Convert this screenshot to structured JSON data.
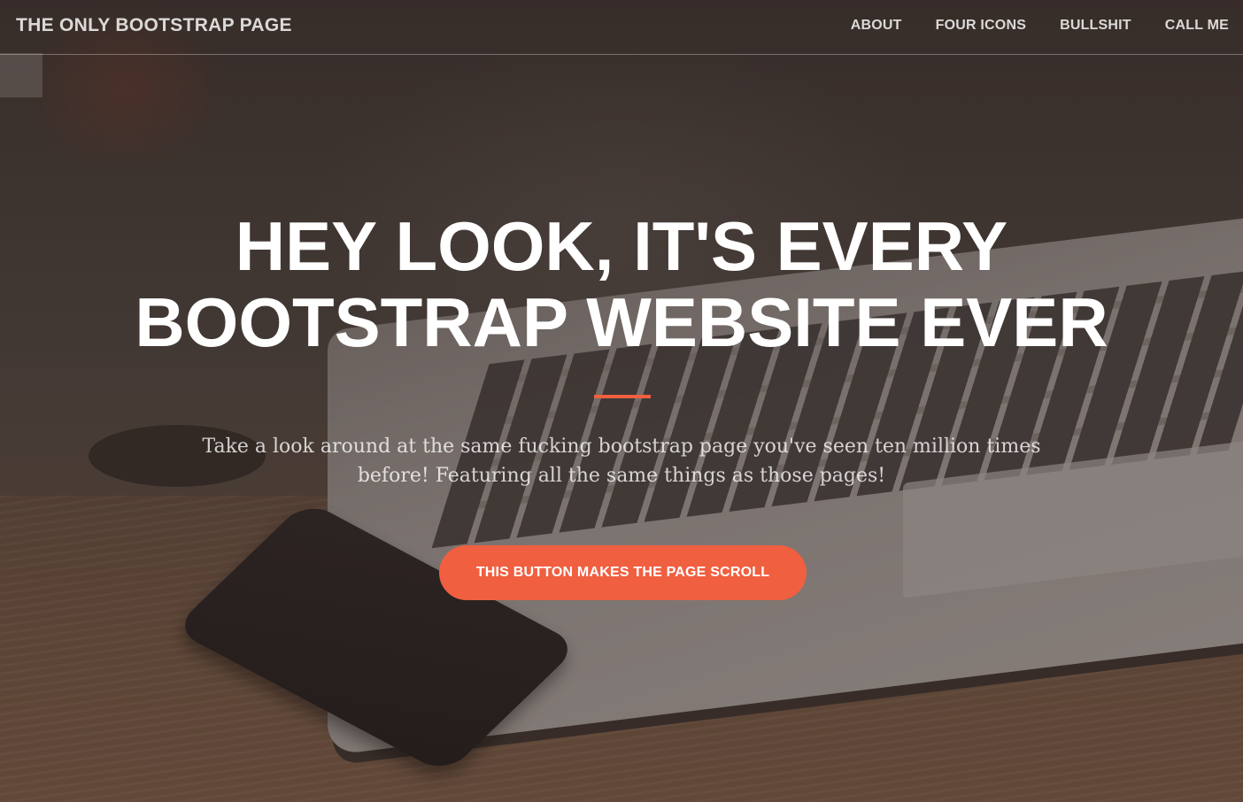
{
  "navbar": {
    "brand": "THE ONLY BOOTSTRAP PAGE",
    "links": [
      "ABOUT",
      "FOUR ICONS",
      "BULLSHIT",
      "CALL ME"
    ]
  },
  "hero": {
    "title_lines": [
      "HEY LOOK, IT'S EVERY",
      "BOOTSTRAP WEBSITE EVER"
    ],
    "text_lines": [
      "Take a look around at the same fucking bootstrap page you've seen ten million times",
      "before! Featuring all the same things as those pages!"
    ],
    "button_label": "THIS BUTTON MAKES THE PAGE SCROLL"
  },
  "colors": {
    "accent": "#f05f40",
    "text": "#ffffff"
  }
}
